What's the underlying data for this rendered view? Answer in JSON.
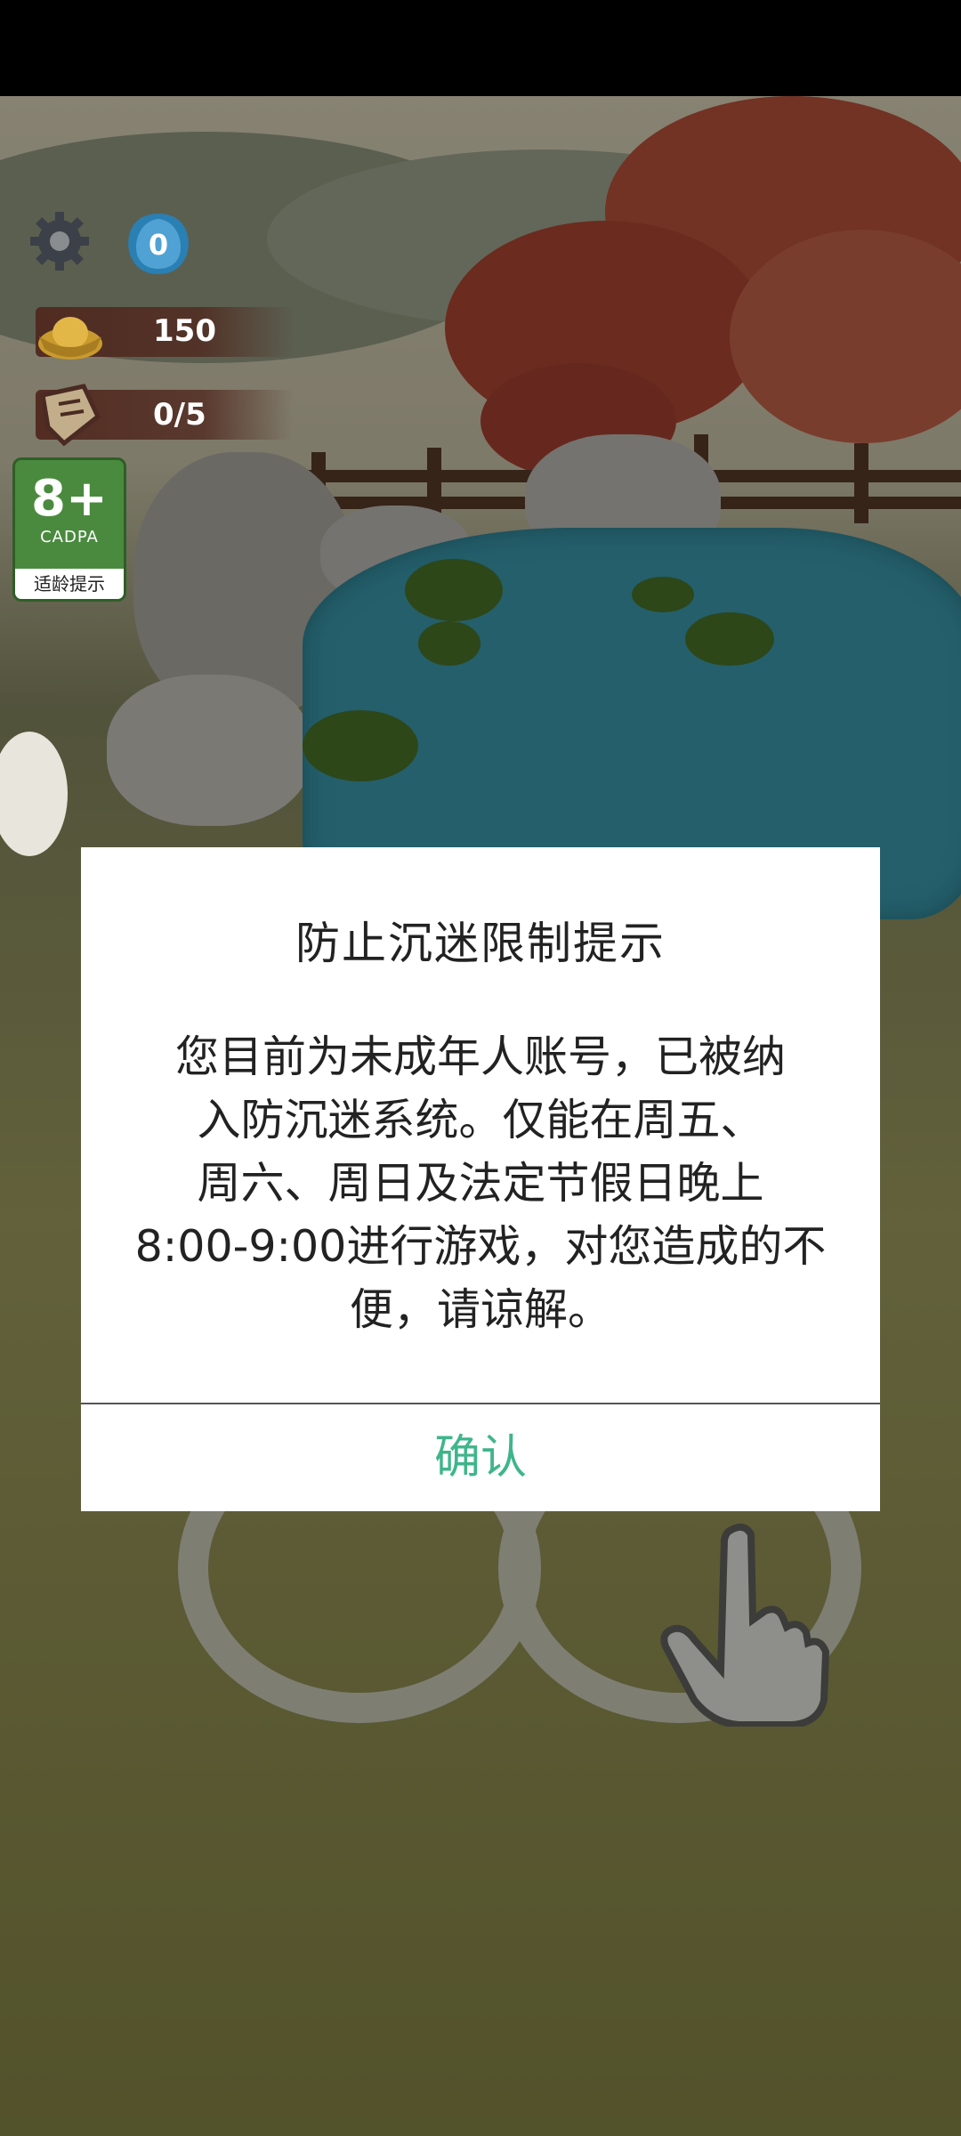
{
  "hud": {
    "shell_count": "0",
    "gold_count": "150",
    "task_count": "0/5",
    "icons": [
      "gear-icon",
      "shell-icon",
      "gold-ingot-icon",
      "task-scroll-icon"
    ]
  },
  "age_rating": {
    "number": "8+",
    "organization": "CADPA",
    "tip": "适龄提示",
    "color": "#4a8a3e"
  },
  "dialog": {
    "title": "防止沉迷限制提示",
    "body_lines": [
      "您目前为未成年人账号，已被纳",
      "入防沉迷系统。仅能在周五、",
      "周六、周日及法定节假日晚上",
      "8:00-9:00进行游戏，对您造成的不",
      "便，请谅解。"
    ],
    "confirm_label": "确认",
    "confirm_color": "#3fb58a"
  }
}
